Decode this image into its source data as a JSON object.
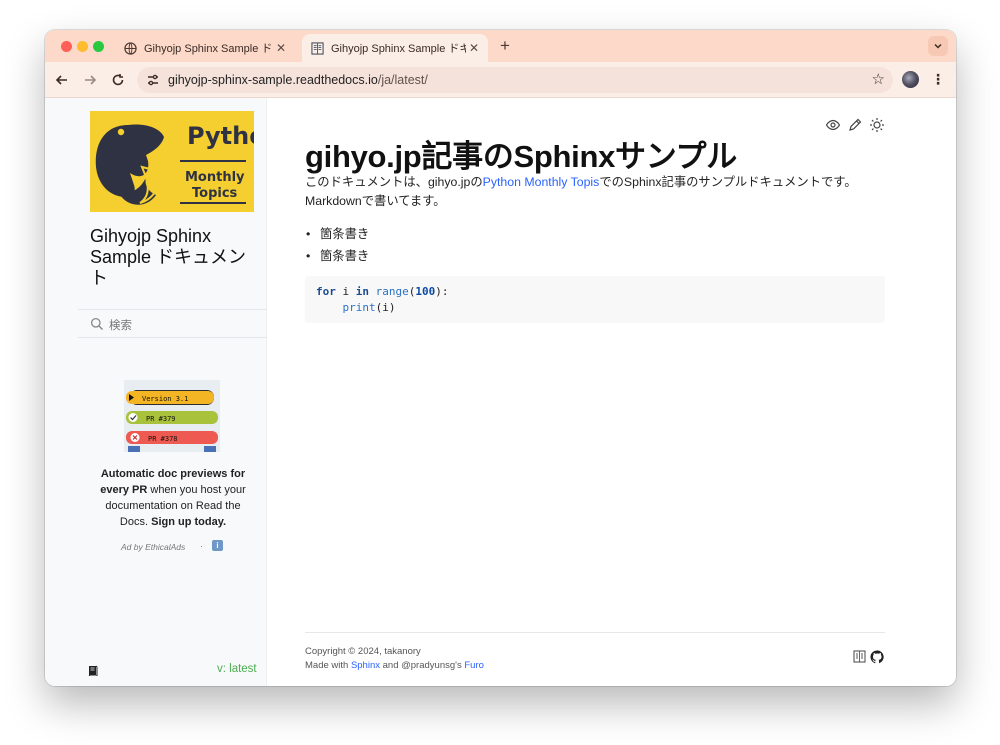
{
  "browser": {
    "tabs": [
      {
        "title": "Gihyojp Sphinx Sample ドキュ",
        "active": false,
        "icon": "globe-icon"
      },
      {
        "title": "Gihyojp Sphinx Sample ドキュ",
        "active": true,
        "icon": "readthedocs-icon"
      }
    ],
    "close_glyph": "✕",
    "new_tab_glyph": "+",
    "url_host": "gihyojp-sphinx-sample.readthedocs.io",
    "url_path": "/ja/latest/",
    "colors": {
      "tabstrip": "#fcd9c8",
      "toolbar": "#fbeee7"
    }
  },
  "sidebar": {
    "logo_alt": "Python Monthly Topics",
    "logo_text_1": "Python",
    "logo_text_2": "Monthly",
    "logo_text_3": "Topics",
    "project_name": "Gihyojp Sphinx Sample ドキュメント",
    "search_placeholder": "検索",
    "ad": {
      "badges": [
        "Version 3.1",
        "PR #379",
        "PR #378"
      ],
      "text_bold_1": "Automatic doc previews for every PR",
      "text_1": " when you host your documentation on Read the Docs. ",
      "text_bold_2": "Sign up today.",
      "by": "Ad by EthicalAds",
      "dot": "·",
      "info": "i"
    },
    "version": "v: latest"
  },
  "main": {
    "title": "gihyo.jp記事のSphinxサンプル",
    "para_before": "このドキュメントは、gihyo.jpの",
    "para_link": "Python Monthly Topis",
    "para_after": "でのSphinx記事のサンプルドキュメントです。Markdownで書いてます。",
    "bullets": [
      "箇条書き",
      "箇条書き"
    ],
    "code": {
      "kw_for": "for",
      "var_i": " i ",
      "kw_in": "in",
      "fn_range": "range",
      "paren_open": "(",
      "num": "100",
      "paren_close": "):",
      "indent": "    ",
      "fn_print": "print",
      "print_args": "(i)"
    }
  },
  "footer": {
    "copyright": "Copyright © 2024, takanory",
    "made_prefix": "Made with ",
    "sphinx": "Sphinx",
    "made_mid": " and @pradyunsg's ",
    "furo": "Furo"
  }
}
